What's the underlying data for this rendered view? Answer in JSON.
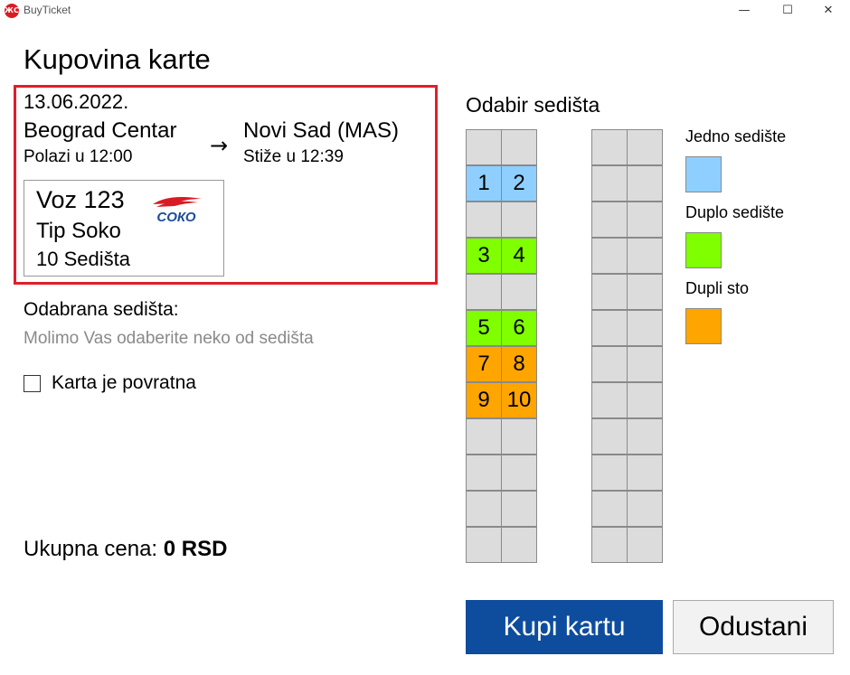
{
  "window": {
    "title": "BuyTicket",
    "icon": "app-logo-icon",
    "controls": {
      "minimize": "—",
      "maximize": "☐",
      "close": "✕"
    }
  },
  "page_title": "Kupovina karte",
  "trip": {
    "date": "13.06.2022.",
    "from_station": "Beograd Centar",
    "departure": "Polazi u 12:00",
    "to_station": "Novi Sad (MAS)",
    "arrival": "Stiže u 12:39",
    "arrow": "→"
  },
  "train": {
    "name": "Voz 123",
    "type": "Tip Soko",
    "seats": "10 Sedišta",
    "logo_text": "СОКО"
  },
  "selected_seats": {
    "label": "Odabrana sedišta:",
    "hint": "Molimo Vas odaberite neko od sedišta"
  },
  "return_ticket": {
    "label": "Karta je povratna",
    "checked": false
  },
  "total": {
    "label": "Ukupna cena: ",
    "value": "0 RSD"
  },
  "seat_selection": {
    "title": "Odabir sedišta",
    "seats": [
      {
        "number": "1",
        "type": "single"
      },
      {
        "number": "2",
        "type": "single"
      },
      {
        "number": "3",
        "type": "double"
      },
      {
        "number": "4",
        "type": "double"
      },
      {
        "number": "5",
        "type": "double"
      },
      {
        "number": "6",
        "type": "double"
      },
      {
        "number": "7",
        "type": "table"
      },
      {
        "number": "8",
        "type": "table"
      },
      {
        "number": "9",
        "type": "table"
      },
      {
        "number": "10",
        "type": "table"
      }
    ]
  },
  "legend": [
    {
      "label": "Jedno sedište",
      "color": "#8ecfff"
    },
    {
      "label": "Duplo sedište",
      "color": "#7fff00"
    },
    {
      "label": "Dupli sto",
      "color": "#ffa500"
    }
  ],
  "buttons": {
    "buy": "Kupi kartu",
    "cancel": "Odustani"
  },
  "colors": {
    "highlight_border": "#e01e2a",
    "buy_button": "#0e4c9e",
    "empty_seat": "#dcdcdc"
  }
}
